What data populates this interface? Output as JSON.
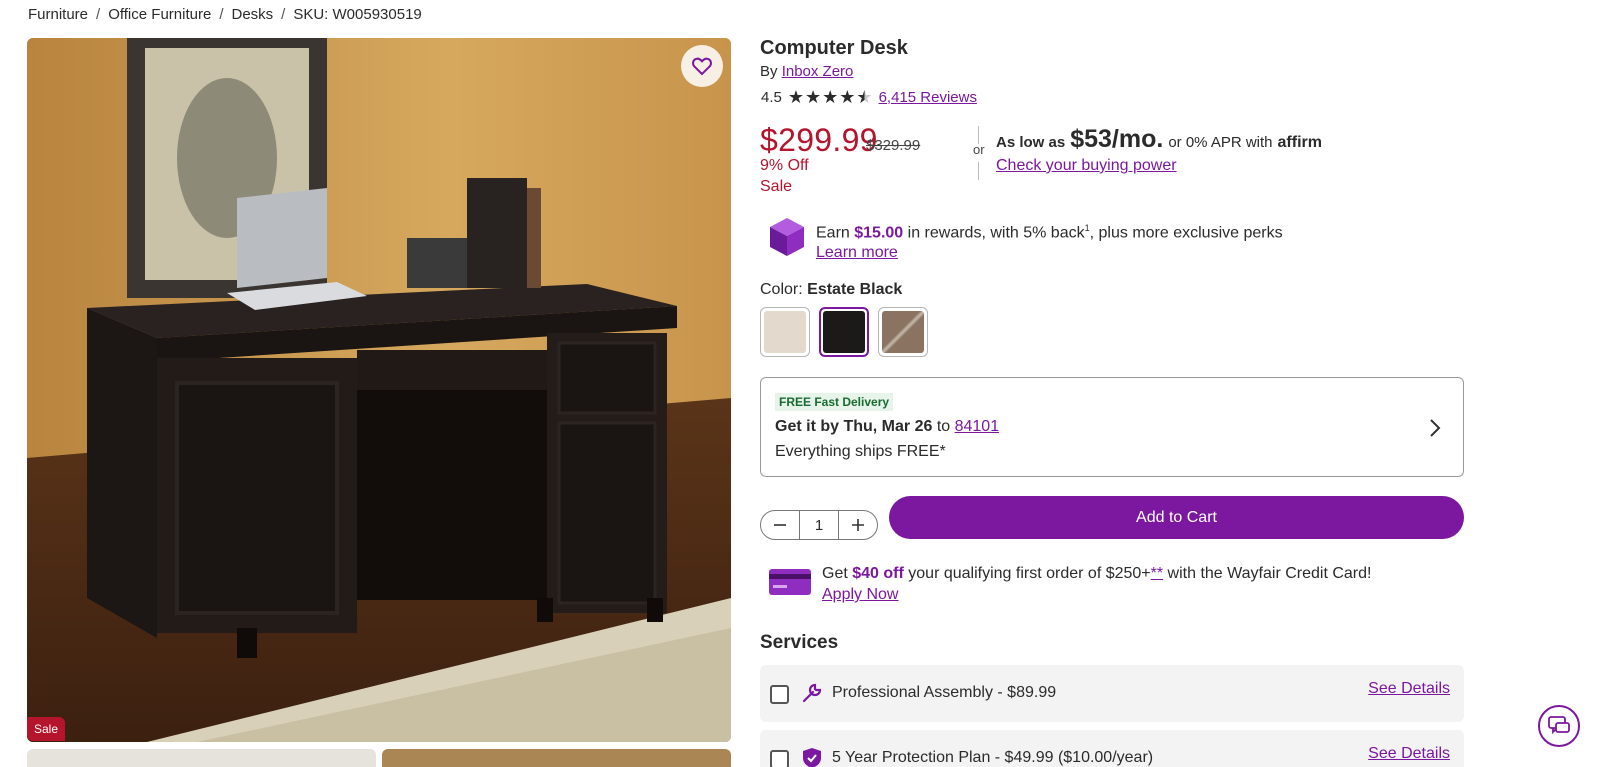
{
  "breadcrumb": {
    "items": [
      "Furniture",
      "Office Furniture",
      "Desks"
    ],
    "sku": "SKU: W005930519",
    "separator": "/"
  },
  "gallery": {
    "sale_tag": "Sale",
    "favorite_icon": "heart-icon"
  },
  "product": {
    "title": "Computer Desk",
    "by_prefix": "By",
    "brand": "Inbox Zero",
    "rating": "4.5",
    "rating_value": 4.5,
    "reviews_link": "6,415 Reviews"
  },
  "pricing": {
    "price": "$299.99",
    "was_price": "$329.99",
    "discount": "9% Off",
    "sale_label": "Sale",
    "or_text": "or",
    "affirm_prefix": "As low as",
    "affirm_amount": "$53/mo.",
    "affirm_mid": "or 0% APR with",
    "affirm_brand": "affirm",
    "affirm_link": "Check your buying power"
  },
  "rewards": {
    "earn": "Earn",
    "amount": "$15.00",
    "text_mid": "in rewards, with 5% back",
    "superscript": "1",
    "text_end": ", plus more exclusive perks",
    "link": "Learn more",
    "icon": "rewards-cube-icon"
  },
  "color": {
    "label": "Color:",
    "selected": "Estate Black",
    "swatches": [
      {
        "name": "Light Wood",
        "color": "#e3d9cc"
      },
      {
        "name": "Estate Black",
        "color": "#1c1a19"
      },
      {
        "name": "Brown Oak",
        "color": "#8a7461"
      }
    ]
  },
  "delivery": {
    "badge": "FREE Fast Delivery",
    "get_it_by": "Get it by Thu, Mar 26",
    "to": "to",
    "zip": "84101",
    "ships": "Everything ships FREE*"
  },
  "cart": {
    "quantity": "1",
    "add_label": "Add to Cart"
  },
  "credit": {
    "get": "Get",
    "amount": "$40 off",
    "mid": "your qualifying first order of $250+",
    "asterisks": "**",
    "end": "with the Wayfair Credit Card!",
    "link": "Apply Now"
  },
  "services": {
    "title": "Services",
    "items": [
      {
        "label": "Professional Assembly - $89.99",
        "details": "See Details",
        "icon": "wrench-icon"
      },
      {
        "label": "5 Year Protection Plan - $49.99 ($10.00/year)",
        "details": "See Details",
        "icon": "shield-icon"
      }
    ]
  },
  "colors": {
    "accent": "#7b189f",
    "sale": "#b4142c"
  }
}
